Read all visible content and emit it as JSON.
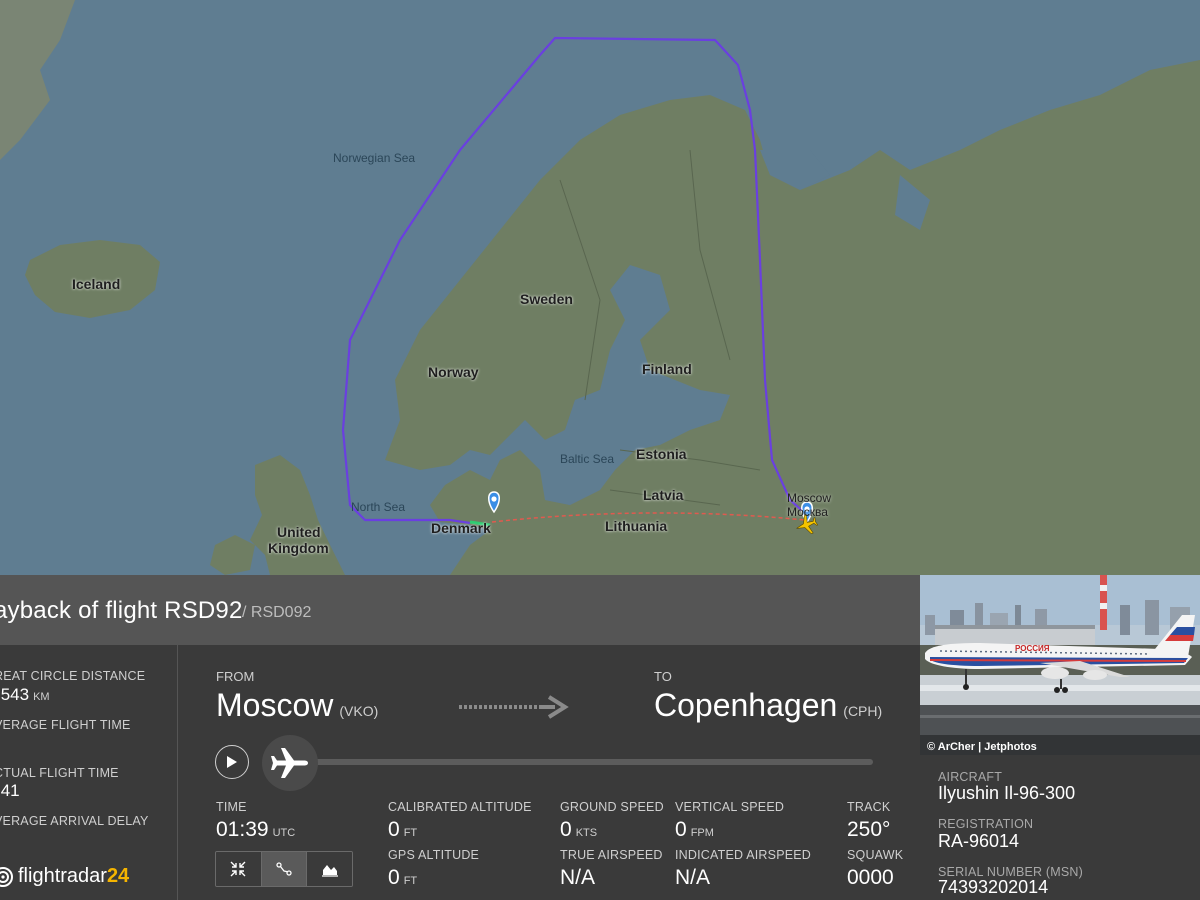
{
  "map": {
    "countries": [
      "Iceland",
      "Norway",
      "Sweden",
      "Finland",
      "Estonia",
      "Latvia",
      "Lithuania",
      "Denmark",
      "United",
      "Kingdom"
    ],
    "seas": [
      "Norwegian Sea",
      "Baltic Sea",
      "North Sea"
    ],
    "cities": [
      "Moscow",
      "Москва"
    ],
    "colors": {
      "water": "#5f7d91",
      "land": "#6f7e63",
      "route_flown": "#6a3fe0",
      "route_planned": "#e05a4f",
      "route_end": "#2ecc71"
    }
  },
  "header": {
    "title": "ayback of flight RSD92",
    "subtitle": "/ RSD092"
  },
  "left": {
    "gcd_label": "REAT CIRCLE DISTANCE",
    "gcd_value": ",543",
    "gcd_unit": "KM",
    "aft_label": "VERAGE FLIGHT TIME",
    "actual_label": "CTUAL FLIGHT TIME",
    "actual_value": ":41",
    "delay_label": "VERAGE ARRIVAL DELAY"
  },
  "route": {
    "from_label": "FROM",
    "from_city": "Moscow",
    "from_code": "(VKO)",
    "to_label": "TO",
    "to_city": "Copenhagen",
    "to_code": "(CPH)"
  },
  "stats": {
    "time_label": "TIME",
    "time_value": "01:39",
    "time_unit": "UTC",
    "cal_alt_label": "CALIBRATED ALTITUDE",
    "cal_alt_value": "0",
    "cal_alt_unit": "FT",
    "gps_alt_label": "GPS ALTITUDE",
    "gps_alt_value": "0",
    "gps_alt_unit": "FT",
    "gs_label": "GROUND SPEED",
    "gs_value": "0",
    "gs_unit": "KTS",
    "tas_label": "TRUE AIRSPEED",
    "tas_value": "N/A",
    "vs_label": "VERTICAL SPEED",
    "vs_value": "0",
    "vs_unit": "FPM",
    "ias_label": "INDICATED AIRSPEED",
    "ias_value": "N/A",
    "track_label": "TRACK",
    "track_value": "250°",
    "squawk_label": "SQUAWK",
    "squawk_value": "0000"
  },
  "aircraft": {
    "photo_credit": "© ArCher | Jetphotos",
    "livery_text": "РОССИЯ",
    "aircraft_label": "AIRCRAFT",
    "aircraft_value": "Ilyushin Il-96-300",
    "reg_label": "REGISTRATION",
    "reg_value": "RA-96014",
    "msn_label": "SERIAL NUMBER (MSN)",
    "msn_value": "74393202014"
  },
  "logo": {
    "text": "flightradar",
    "number": "24"
  }
}
